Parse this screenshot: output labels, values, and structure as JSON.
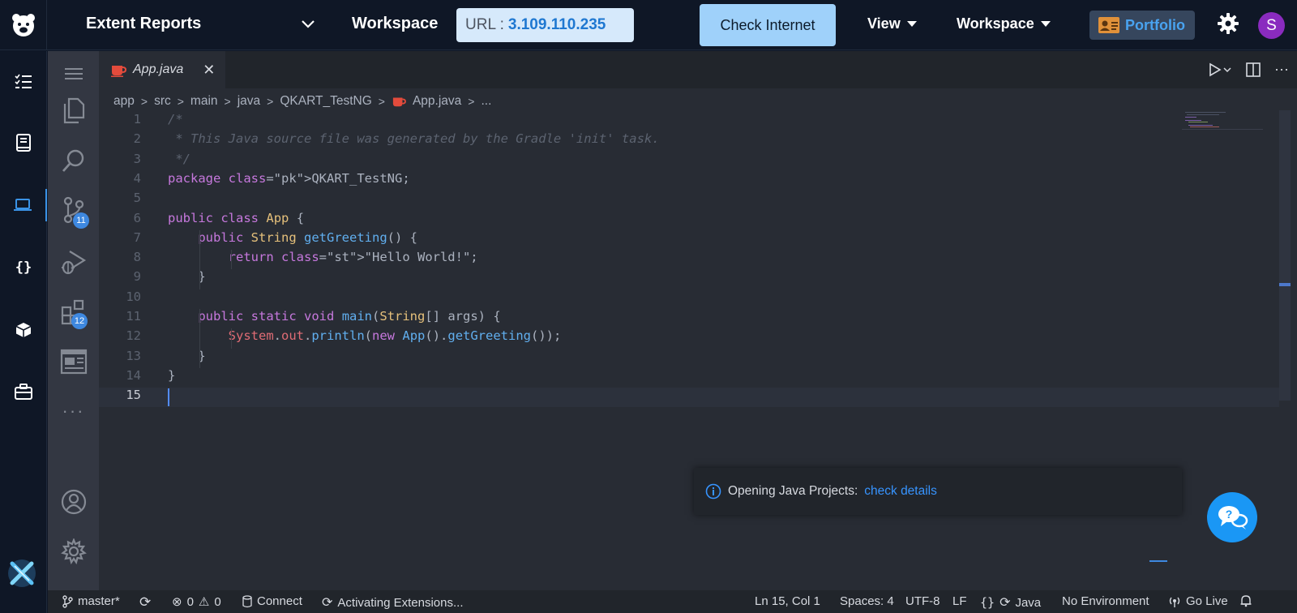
{
  "topbar": {
    "project_title": "Extent Reports",
    "workspace_title": "Workspace",
    "url_label": "URL :",
    "url_value": "3.109.110.235",
    "check_button": "Check Internet",
    "menu_view": "View",
    "menu_workspace": "Workspace",
    "portfolio_label": "Portfolio",
    "avatar_initial": "S"
  },
  "rail": {
    "items": [
      "tasks-icon",
      "book-icon",
      "laptop-icon",
      "braces-icon",
      "cube-icon",
      "briefcase-icon"
    ],
    "active_item": "laptop-icon"
  },
  "activity_bar": {
    "source_control_badge": "11",
    "extensions_badge": "12"
  },
  "editor": {
    "tab_label": "App.java",
    "breadcrumbs": [
      "app",
      "src",
      "main",
      "java",
      "QKART_TestNG",
      "App.java",
      "..."
    ],
    "current_line": 15,
    "lines": [
      "/*",
      " * This Java source file was generated by the Gradle 'init' task.",
      " */",
      "package QKART_TestNG;",
      "",
      "public class App {",
      "    public String getGreeting() {",
      "        return \"Hello World!\";",
      "    }",
      "",
      "    public static void main(String[] args) {",
      "        System.out.println(new App().getGreeting());",
      "    }",
      "}",
      ""
    ]
  },
  "notification": {
    "message": "Opening Java Projects:",
    "link": "check details"
  },
  "statusbar": {
    "branch": "master*",
    "errors": "0",
    "warnings": "0",
    "connect": "Connect",
    "activity": "Activating Extensions...",
    "position": "Ln 15, Col 1",
    "spaces": "Spaces: 4",
    "encoding": "UTF-8",
    "eol": "LF",
    "language": "Java",
    "environment": "No Environment",
    "go_live": "Go Live"
  },
  "colors": {
    "accent": "#3e88e0",
    "check_button_bg": "#9fd1fa",
    "url_box_bg": "#d6e9fb",
    "chat_button": "#1a97f5",
    "avatar": "#8a2bbf"
  }
}
